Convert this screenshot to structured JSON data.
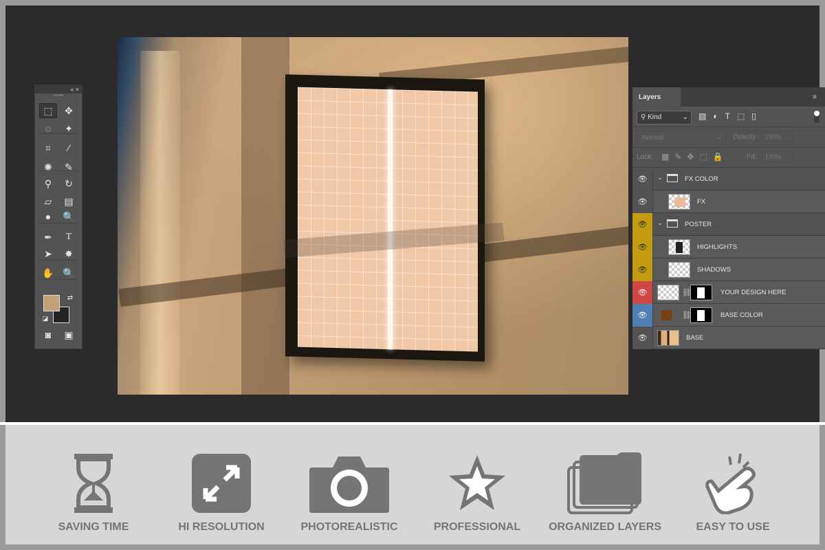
{
  "toolbox": {
    "collapse_label": "«",
    "close_label": "×",
    "colors": {
      "foreground": "#c4a07a",
      "background": "#232323"
    },
    "tools": [
      {
        "name": "rectangular-marquee-tool-icon",
        "glyph": "⬚"
      },
      {
        "name": "move-tool-icon",
        "glyph": "✥"
      },
      {
        "name": "lasso-tool-icon",
        "glyph": "◌"
      },
      {
        "name": "magic-wand-tool-icon",
        "glyph": "✦"
      },
      {
        "name": "crop-tool-icon",
        "glyph": "⌗"
      },
      {
        "name": "eyedropper-tool-icon",
        "glyph": "⁄"
      },
      {
        "name": "healing-brush-tool-icon",
        "glyph": "✺"
      },
      {
        "name": "brush-tool-icon",
        "glyph": "✎"
      },
      {
        "name": "clone-stamp-tool-icon",
        "glyph": "⚲"
      },
      {
        "name": "history-brush-tool-icon",
        "glyph": "↻"
      },
      {
        "name": "eraser-tool-icon",
        "glyph": "▱"
      },
      {
        "name": "gradient-tool-icon",
        "glyph": "▤"
      },
      {
        "name": "blur-tool-icon",
        "glyph": "●"
      },
      {
        "name": "dodge-tool-icon",
        "glyph": "🔍"
      },
      {
        "name": "pen-tool-icon",
        "glyph": "✒"
      },
      {
        "name": "type-tool-icon",
        "glyph": "T"
      },
      {
        "name": "path-selection-tool-icon",
        "glyph": "➤"
      },
      {
        "name": "custom-shape-tool-icon",
        "glyph": "✸"
      },
      {
        "name": "hand-tool-icon",
        "glyph": "✋"
      },
      {
        "name": "zoom-tool-icon",
        "glyph": "🔍"
      },
      {
        "name": "quick-mask-icon",
        "glyph": "◙"
      },
      {
        "name": "screen-mode-icon",
        "glyph": "▣"
      }
    ]
  },
  "layers_panel": {
    "tab_label": "Layers",
    "menu_glyph": "≡",
    "kind_label": "Kind",
    "filter_glyphs": [
      "▨",
      "◐",
      "T",
      "⬚",
      "▯"
    ],
    "blend_mode": "Normal",
    "opacity_label": "Opacity:",
    "opacity_value": "100%",
    "lock_label": "Lock:",
    "lock_glyphs": [
      "▦",
      "✎",
      "✥",
      "⬚",
      "🔒"
    ],
    "fill_label": "Fill:",
    "fill_value": "100%",
    "eye_glyph": "👁",
    "layers": [
      {
        "name": "FX COLOR"
      },
      {
        "name": "FX"
      },
      {
        "name": "POSTER"
      },
      {
        "name": "HIGHLIGHTS"
      },
      {
        "name": "SHADOWS"
      },
      {
        "name": "YOUR DESIGN HERE"
      },
      {
        "name": "BASE COLOR"
      },
      {
        "name": "BASE"
      }
    ],
    "eye_colors": {
      "yellow": "#c39a12",
      "red": "#d04646",
      "blue": "#4f7fb3"
    },
    "base_color_swatch": "#7a3e12"
  },
  "features": [
    {
      "label": "SAVING TIME",
      "icon": "hourglass-icon"
    },
    {
      "label": "HI RESOLUTION",
      "icon": "expand-arrows-icon"
    },
    {
      "label": "PHOTOREALISTIC",
      "icon": "camera-icon"
    },
    {
      "label": "PROFESSIONAL",
      "icon": "star-icon"
    },
    {
      "label": "ORGANIZED LAYERS",
      "icon": "layers-folder-icon"
    },
    {
      "label": "EASY TO USE",
      "icon": "pointing-hand-icon"
    }
  ]
}
